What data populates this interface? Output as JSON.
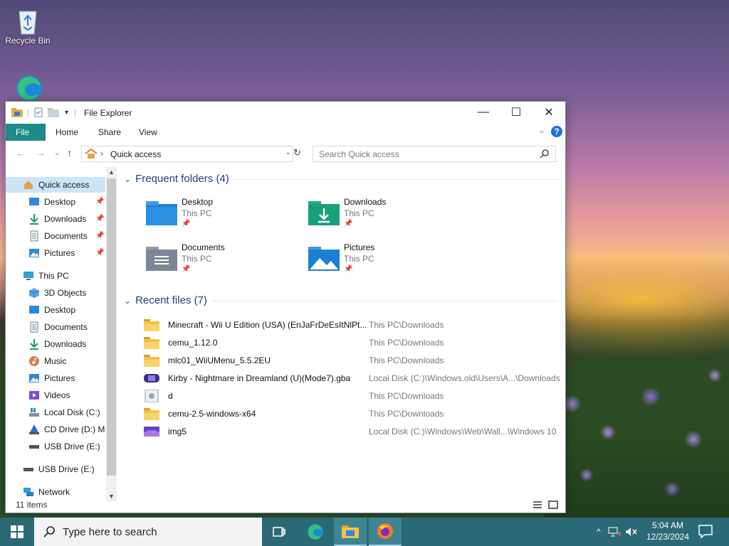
{
  "desktop": {
    "icons": [
      {
        "label": "Recycle Bin",
        "icon": "recycle-bin-icon"
      },
      {
        "label": "",
        "icon": "edge-icon"
      }
    ]
  },
  "window": {
    "title": "File Explorer",
    "controls": {
      "minimize": "—",
      "maximize": "☐",
      "close": "✕"
    },
    "ribbon_tabs": [
      "File",
      "Home",
      "Share",
      "View"
    ],
    "help": "?",
    "address": {
      "path": "Quick access"
    },
    "search": {
      "placeholder": "Search Quick access"
    },
    "nav_pane": {
      "items": [
        {
          "label": "Quick access",
          "icon": "star-icon",
          "selected": true,
          "indent": 0
        },
        {
          "label": "Desktop",
          "icon": "desktop-icon",
          "pinned": true,
          "indent": 1
        },
        {
          "label": "Downloads",
          "icon": "download-icon",
          "pinned": true,
          "indent": 1
        },
        {
          "label": "Documents",
          "icon": "document-icon",
          "pinned": true,
          "indent": 1
        },
        {
          "label": "Pictures",
          "icon": "pictures-icon",
          "pinned": true,
          "indent": 1
        },
        {
          "label": "This PC",
          "icon": "computer-icon",
          "indent": 0
        },
        {
          "label": "3D Objects",
          "icon": "cube-icon",
          "indent": 1
        },
        {
          "label": "Desktop",
          "icon": "desktop-icon",
          "indent": 1
        },
        {
          "label": "Documents",
          "icon": "document-icon",
          "indent": 1
        },
        {
          "label": "Downloads",
          "icon": "download-icon",
          "indent": 1
        },
        {
          "label": "Music",
          "icon": "music-icon",
          "indent": 1
        },
        {
          "label": "Pictures",
          "icon": "pictures-icon",
          "indent": 1
        },
        {
          "label": "Videos",
          "icon": "video-icon",
          "indent": 1
        },
        {
          "label": "Local Disk (C:)",
          "icon": "drive-icon",
          "indent": 1
        },
        {
          "label": "CD Drive (D:) Ma",
          "icon": "cd-drive-icon",
          "indent": 1
        },
        {
          "label": "USB Drive (E:)",
          "icon": "usb-drive-icon",
          "indent": 1
        },
        {
          "label": "USB Drive (E:)",
          "icon": "usb-drive-icon",
          "indent": 0
        },
        {
          "label": "Network",
          "icon": "network-icon",
          "indent": 0
        }
      ]
    },
    "frequent": {
      "heading": "Frequent folders (4)",
      "folders": [
        {
          "name": "Desktop",
          "location": "This PC",
          "icon": "desktop-folder-icon"
        },
        {
          "name": "Downloads",
          "location": "This PC",
          "icon": "downloads-folder-icon"
        },
        {
          "name": "Documents",
          "location": "This PC",
          "icon": "documents-folder-icon"
        },
        {
          "name": "Pictures",
          "location": "This PC",
          "icon": "pictures-folder-icon"
        }
      ]
    },
    "recent": {
      "heading": "Recent files (7)",
      "files": [
        {
          "name": "Minecraft - Wii U Edition (USA) (EnJaFrDeEsItNlPt...",
          "location": "This PC\\Downloads",
          "icon": "folder-icon"
        },
        {
          "name": "cemu_1.12.0",
          "location": "This PC\\Downloads",
          "icon": "folder-icon"
        },
        {
          "name": "mlc01_WiiUMenu_5.5.2EU",
          "location": "This PC\\Downloads",
          "icon": "folder-icon"
        },
        {
          "name": "Kirby - Nightmare in Dreamland (U)(Mode7).gba",
          "location": "Local Disk (C:)\\Windows.old\\Users\\A...\\Downloads",
          "icon": "gba-file-icon"
        },
        {
          "name": "d",
          "location": "This PC\\Downloads",
          "icon": "image-file-icon"
        },
        {
          "name": "cemu-2.5-windows-x64",
          "location": "This PC\\Downloads",
          "icon": "folder-icon"
        },
        {
          "name": "img5",
          "location": "Local Disk (C:)\\Windows\\Web\\Wall...\\Windows 10",
          "icon": "image-thumbnail-icon"
        }
      ]
    },
    "status": {
      "items": "11 items"
    }
  },
  "taskbar": {
    "search_placeholder": "Type here to search",
    "clock": {
      "time": "5:04 AM",
      "date": "12/23/2024"
    }
  },
  "colors": {
    "accent": "#1f8a8a",
    "taskbar": "#2c6977",
    "selection": "#cce4f7",
    "heading": "#1e3f7a"
  }
}
